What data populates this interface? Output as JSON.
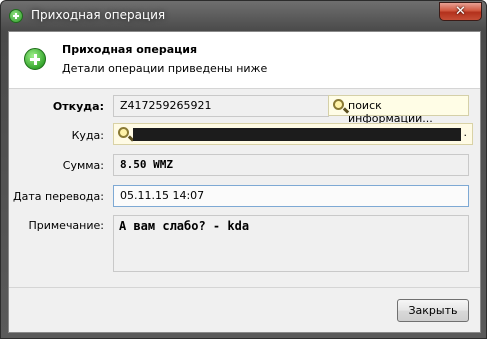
{
  "window": {
    "title": "Приходная операция",
    "close_glyph": "✕",
    "icon": "green-plus-icon"
  },
  "header": {
    "title": "Приходная операция",
    "subtitle": "Детали операции приведены ниже",
    "icon": "green-plus-icon"
  },
  "form": {
    "from_label": "Откуда:",
    "from_value": "Z417259265921",
    "search_label": "поиск информации...",
    "to_label": "Куда:",
    "to_value_suffix": ".",
    "amount_label": "Сумма:",
    "amount_value": "8.50 WMZ",
    "date_label": "Дата перевода:",
    "date_value": "05.11.15 14:07",
    "note_label": "Примечание:",
    "note_value": "А вам слабо? - kda"
  },
  "footer": {
    "close_label": "Закрыть"
  },
  "colors": {
    "accent_green": "#38a72f",
    "close_red": "#c64e36",
    "highlight_yellow": "#fffde6"
  }
}
